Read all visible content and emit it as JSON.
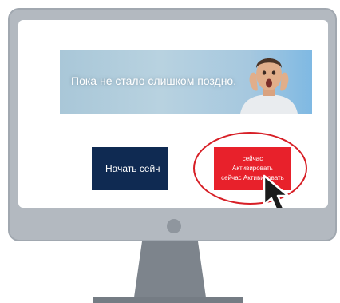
{
  "banner": {
    "text": "Пока не стало слишком поздно."
  },
  "start_button": {
    "label": "Начать сейч"
  },
  "activate_button": {
    "lines": [
      "сейчас",
      "Активировать",
      "сейчас Активировать"
    ]
  },
  "colors": {
    "monitor_body": "#b3b9c0",
    "screen": "#ffffff",
    "stand": "#7d848c",
    "start_button": "#0f2a52",
    "activate_button": "#e8212b",
    "highlight": "#d71f26"
  },
  "icons": {
    "cursor": "mouse-pointer-icon",
    "power": "power-button-icon"
  }
}
